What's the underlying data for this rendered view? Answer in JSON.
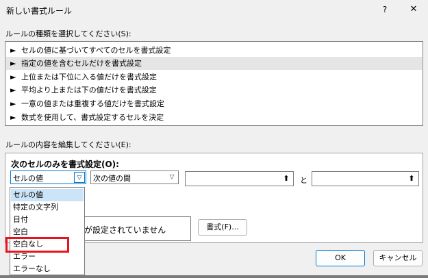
{
  "dialog": {
    "title": "新しい書式ルール",
    "help": "?",
    "close": "✕"
  },
  "rule_type": {
    "label": "ルールの種類を選択してください(S):",
    "items": [
      {
        "label": "セルの値に基づいてすべてのセルを書式設定",
        "selected": false
      },
      {
        "label": "指定の値を含むセルだけを書式設定",
        "selected": true
      },
      {
        "label": "上位または下位に入る値だけを書式設定",
        "selected": false
      },
      {
        "label": "平均より上または下の値だけを書式設定",
        "selected": false
      },
      {
        "label": "一意の値または重複する値だけを書式設定",
        "selected": false
      },
      {
        "label": "数式を使用して、書式設定するセルを決定",
        "selected": false
      }
    ],
    "arrow": "►"
  },
  "rule_content": {
    "label": "ルールの内容を編集してください(E):",
    "condition_title": "次のセルのみを書式設定(O):",
    "select1_value": "セルの値",
    "select2_value": "次の値の間",
    "and_label": "と",
    "ref_icon": "⬆",
    "preview_text": "が設定されていません",
    "format_button": "書式(F)..."
  },
  "dropdown": {
    "options": [
      {
        "label": "セルの値",
        "active": true
      },
      {
        "label": "特定の文字列",
        "active": false
      },
      {
        "label": "日付",
        "active": false
      },
      {
        "label": "空白",
        "active": false
      },
      {
        "label": "空白なし",
        "active": false
      },
      {
        "label": "エラー",
        "active": false
      },
      {
        "label": "エラーなし",
        "active": false
      }
    ]
  },
  "buttons": {
    "ok": "OK",
    "cancel": "キャンセル"
  },
  "highlight_color": "#e8141d",
  "accent_color": "#0078d4"
}
